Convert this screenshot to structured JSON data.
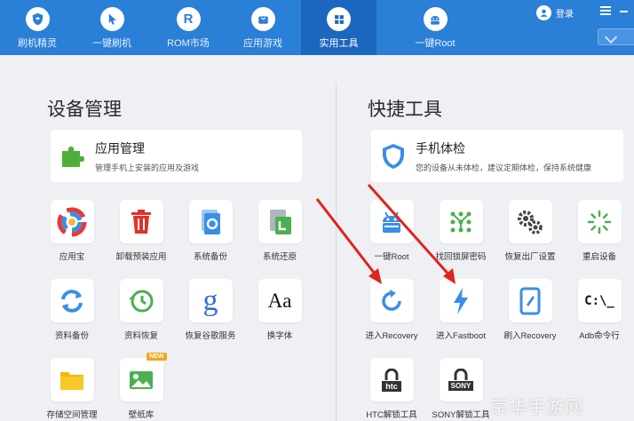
{
  "nav": [
    {
      "label": "刷机精灵",
      "icon": "shield-icon"
    },
    {
      "label": "一键刷机",
      "icon": "cursor-icon"
    },
    {
      "label": "ROM市场",
      "icon": "r-letter-icon"
    },
    {
      "label": "应用游戏",
      "icon": "store-bag-icon"
    },
    {
      "label": "实用工具",
      "icon": "grid-icon",
      "active": true
    },
    {
      "label": "一键Root",
      "icon": "android-robot-icon"
    }
  ],
  "header": {
    "login_label": "登录"
  },
  "device_mgmt": {
    "title": "设备管理",
    "card": {
      "title": "应用管理",
      "desc": "管理手机上安装的应用及游戏",
      "icon": "puzzle-icon"
    },
    "tiles": [
      {
        "label": "应用宝",
        "icon": "app-store-icon"
      },
      {
        "label": "卸载预装应用",
        "icon": "trash-icon"
      },
      {
        "label": "系统备份",
        "icon": "system-backup-icon"
      },
      {
        "label": "系统还原",
        "icon": "system-restore-icon"
      },
      {
        "label": "资料备份",
        "icon": "refresh-cycle-icon"
      },
      {
        "label": "资料恢复",
        "icon": "history-clock-icon"
      },
      {
        "label": "恢复谷歌服务",
        "icon": "google-g-icon"
      },
      {
        "label": "换字体",
        "icon": "font-aa-icon",
        "glyph": "Aa"
      },
      {
        "label": "存储空间管理",
        "icon": "folder-icon"
      },
      {
        "label": "壁纸库",
        "icon": "picture-icon",
        "badge": "NEW"
      }
    ]
  },
  "quick_tools": {
    "title": "快捷工具",
    "card": {
      "title": "手机体检",
      "desc": "您的设备从未体检，建议定期体检，保持系统健康",
      "icon": "shield-check-icon"
    },
    "tiles": [
      {
        "label": "一键Root",
        "icon": "android-robot-icon"
      },
      {
        "label": "找回锁屏密码",
        "icon": "pattern-lock-icon"
      },
      {
        "label": "恢复出厂设置",
        "icon": "gears-icon"
      },
      {
        "label": "重启设备",
        "icon": "loading-spinner-icon"
      },
      {
        "label": "进入Recovery",
        "icon": "rotate-arrow-icon"
      },
      {
        "label": "进入Fastboot",
        "icon": "lightning-icon"
      },
      {
        "label": "刷入Recovery",
        "icon": "phone-edit-icon"
      },
      {
        "label": "Adb命令行",
        "icon": "terminal-icon",
        "glyph": "C:\\_"
      },
      {
        "label": "HTC解锁工具",
        "icon": "htc-lock-icon",
        "glyph": "htc"
      },
      {
        "label": "SONY解锁工具",
        "icon": "sony-lock-icon",
        "glyph": "SONY"
      }
    ]
  },
  "watermark": "京华手游网",
  "colors": {
    "topbar": "#2a7fd6",
    "active_tab": "#1b66bf",
    "accent_blue": "#3a8ee6",
    "annotation_arrow": "#e0241b"
  }
}
